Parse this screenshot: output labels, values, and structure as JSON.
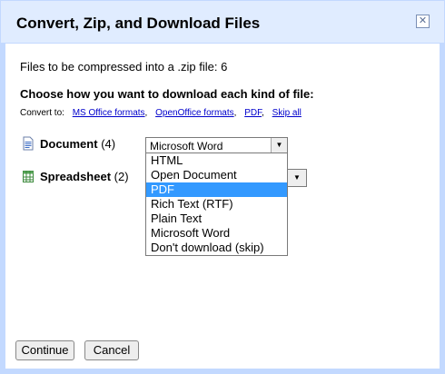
{
  "dialog": {
    "title": "Convert, Zip, and Download Files",
    "close_glyph": "✕",
    "info": "Files to be compressed into a .zip file: 6",
    "choose_heading": "Choose how you want to download each kind of file:",
    "convert_to_label": "Convert to:",
    "convert_links": [
      "MS Office formats",
      "OpenOffice formats",
      "PDF",
      "Skip all"
    ],
    "link_separators": [
      ",",
      ",",
      ","
    ]
  },
  "file_types": {
    "document": {
      "label": "Document",
      "count": "(4)",
      "selected_value": "Microsoft Word"
    },
    "spreadsheet": {
      "label": "Spreadsheet",
      "count": "(2)"
    }
  },
  "dropdown": {
    "options": [
      "HTML",
      "Open Document",
      "PDF",
      "Rich Text (RTF)",
      "Plain Text",
      "Microsoft Word",
      "Don't download (skip)"
    ],
    "highlighted_index": 2
  },
  "buttons": {
    "continue": "Continue",
    "cancel": "Cancel"
  },
  "colors": {
    "titlebar": "#e0ecff",
    "frame": "#c3d9ff",
    "link": "#0000cc",
    "highlight": "#3399ff"
  },
  "icons": {
    "document": "document-icon",
    "spreadsheet": "spreadsheet-icon",
    "dropdown_arrow": "chevron-down-icon",
    "close": "close-icon"
  }
}
